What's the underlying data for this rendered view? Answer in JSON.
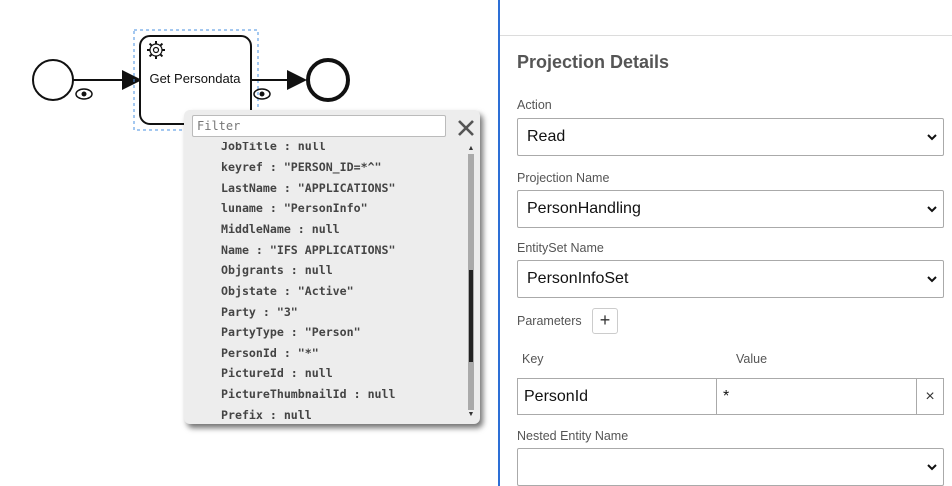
{
  "diagram": {
    "task_label": "Get Persondata"
  },
  "popup": {
    "filter_placeholder": "Filter",
    "properties": [
      "JobTitle : null",
      "keyref : \"PERSON_ID=*^\"",
      "LastName : \"APPLICATIONS\"",
      "luname : \"PersonInfo\"",
      "MiddleName : null",
      "Name : \"IFS APPLICATIONS\"",
      "Objgrants : null",
      "Objstate : \"Active\"",
      "Party : \"3\"",
      "PartyType : \"Person\"",
      "PersonId : \"*\"",
      "PictureId : null",
      "PictureThumbnailId : null",
      "Prefix : null"
    ]
  },
  "panel": {
    "title": "Projection Details",
    "action_label": "Action",
    "action_value": "Read",
    "projection_label": "Projection Name",
    "projection_value": "PersonHandling",
    "entityset_label": "EntitySet Name",
    "entityset_value": "PersonInfoSet",
    "parameters_label": "Parameters",
    "add_symbol": "+",
    "key_header": "Key",
    "value_header": "Value",
    "param_key": "PersonId",
    "param_value": "*",
    "remove_symbol": "×",
    "nested_label": "Nested Entity Name",
    "nested_value": ""
  },
  "colors": {
    "divider": "#2d6fd6",
    "popup_bg": "#ededed"
  }
}
